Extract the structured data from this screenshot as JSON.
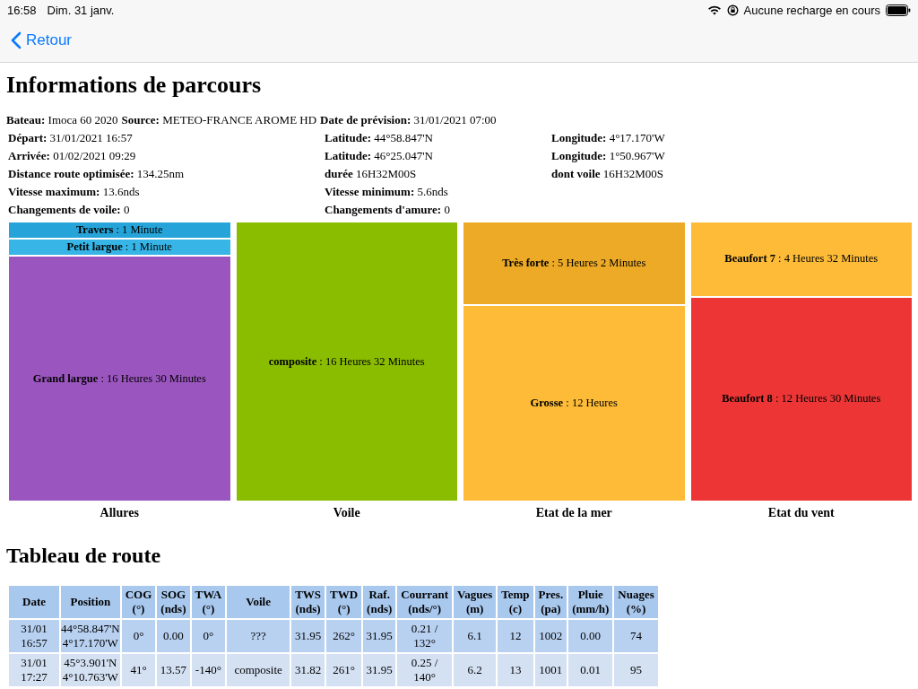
{
  "status_bar": {
    "time": "16:58",
    "date": "Dim. 31 janv.",
    "charging": "Aucune recharge en cours"
  },
  "nav": {
    "back": "Retour"
  },
  "title": "Informations de parcours",
  "summary": [
    {
      "label": "Bateau:",
      "value": "Imoca 60 2020"
    },
    {
      "label": "Source:",
      "value": "METEO-FRANCE AROME HD"
    },
    {
      "label": "Date de prévision:",
      "value": "31/01/2021 07:00"
    }
  ],
  "info_rows": [
    [
      {
        "label": "Départ:",
        "value": "31/01/2021 16:57"
      },
      {
        "label": "Latitude:",
        "value": "44°58.847'N"
      },
      {
        "label": "Longitude:",
        "value": "4°17.170'W"
      }
    ],
    [
      {
        "label": "Arrivée:",
        "value": "01/02/2021 09:29"
      },
      {
        "label": "Latitude:",
        "value": "46°25.047'N"
      },
      {
        "label": "Longitude:",
        "value": "1°50.967'W"
      }
    ],
    [
      {
        "label": "Distance route optimisée:",
        "value": "134.25nm"
      },
      {
        "label": "durée",
        "value": "16H32M00S"
      },
      {
        "label": "dont voile",
        "value": "16H32M00S"
      }
    ],
    [
      {
        "label": "Vitesse maximum:",
        "value": "13.6nds"
      },
      {
        "label": "Vitesse minimum:",
        "value": "5.6nds"
      }
    ],
    [
      {
        "label": "Changements de voile:",
        "value": "0"
      },
      {
        "label": "Changements d'amure:",
        "value": "0"
      }
    ]
  ],
  "treemaps": [
    {
      "caption": "Allures",
      "blocks": [
        {
          "label": "Travers",
          "value": ": 1 Minute",
          "color": "#26a4d9"
        },
        {
          "label": "Petit largue",
          "value": ": 1 Minute",
          "color": "#36b5e6"
        },
        {
          "label": "Grand largue",
          "value": ": 16 Heures 30 Minutes",
          "color": "#9b55bf"
        }
      ]
    },
    {
      "caption": "Voile",
      "blocks": [
        {
          "label": "composite",
          "value": ": 16 Heures 32 Minutes",
          "color": "#8abc00"
        }
      ]
    },
    {
      "caption": "Etat de la mer",
      "blocks": [
        {
          "label": "Très forte",
          "value": ": 5 Heures 2 Minutes",
          "color": "#edaa26"
        },
        {
          "label": "Grosse",
          "value": ": 12 Heures",
          "color": "#fdbb37"
        }
      ]
    },
    {
      "caption": "Etat du vent",
      "blocks": [
        {
          "label": "Beaufort 7",
          "value": ": 4 Heures 32 Minutes",
          "color": "#fdbb37"
        },
        {
          "label": "Beaufort 8",
          "value": ": 12 Heures 30 Minutes",
          "color": "#ee3535"
        }
      ]
    }
  ],
  "route_title": "Tableau de route",
  "table": {
    "columns": [
      "Date",
      "Position",
      "COG\n(°)",
      "SOG\n(nds)",
      "TWA\n(°)",
      "Voile",
      "TWS\n(nds)",
      "TWD\n(°)",
      "Raf.\n(nds)",
      "Courrant\n(nds/°)",
      "Vagues\n(m)",
      "Temp\n(c)",
      "Pres.\n(pa)",
      "Pluie\n(mm/h)",
      "Nuages\n(%)"
    ],
    "rows": [
      [
        "31/01\n16:57",
        "44°58.847'N\n4°17.170'W",
        "0°",
        "0.00",
        "0°",
        "???",
        "31.95",
        "262°",
        "31.95",
        "0.21 /\n132°",
        "6.1",
        "12",
        "1002",
        "0.00",
        "74"
      ],
      [
        "31/01\n17:27",
        "45°3.901'N\n4°10.763'W",
        "41°",
        "13.57",
        "-140°",
        "composite",
        "31.82",
        "261°",
        "31.95",
        "0.25 /\n140°",
        "6.2",
        "13",
        "1001",
        "0.01",
        "95"
      ]
    ]
  }
}
